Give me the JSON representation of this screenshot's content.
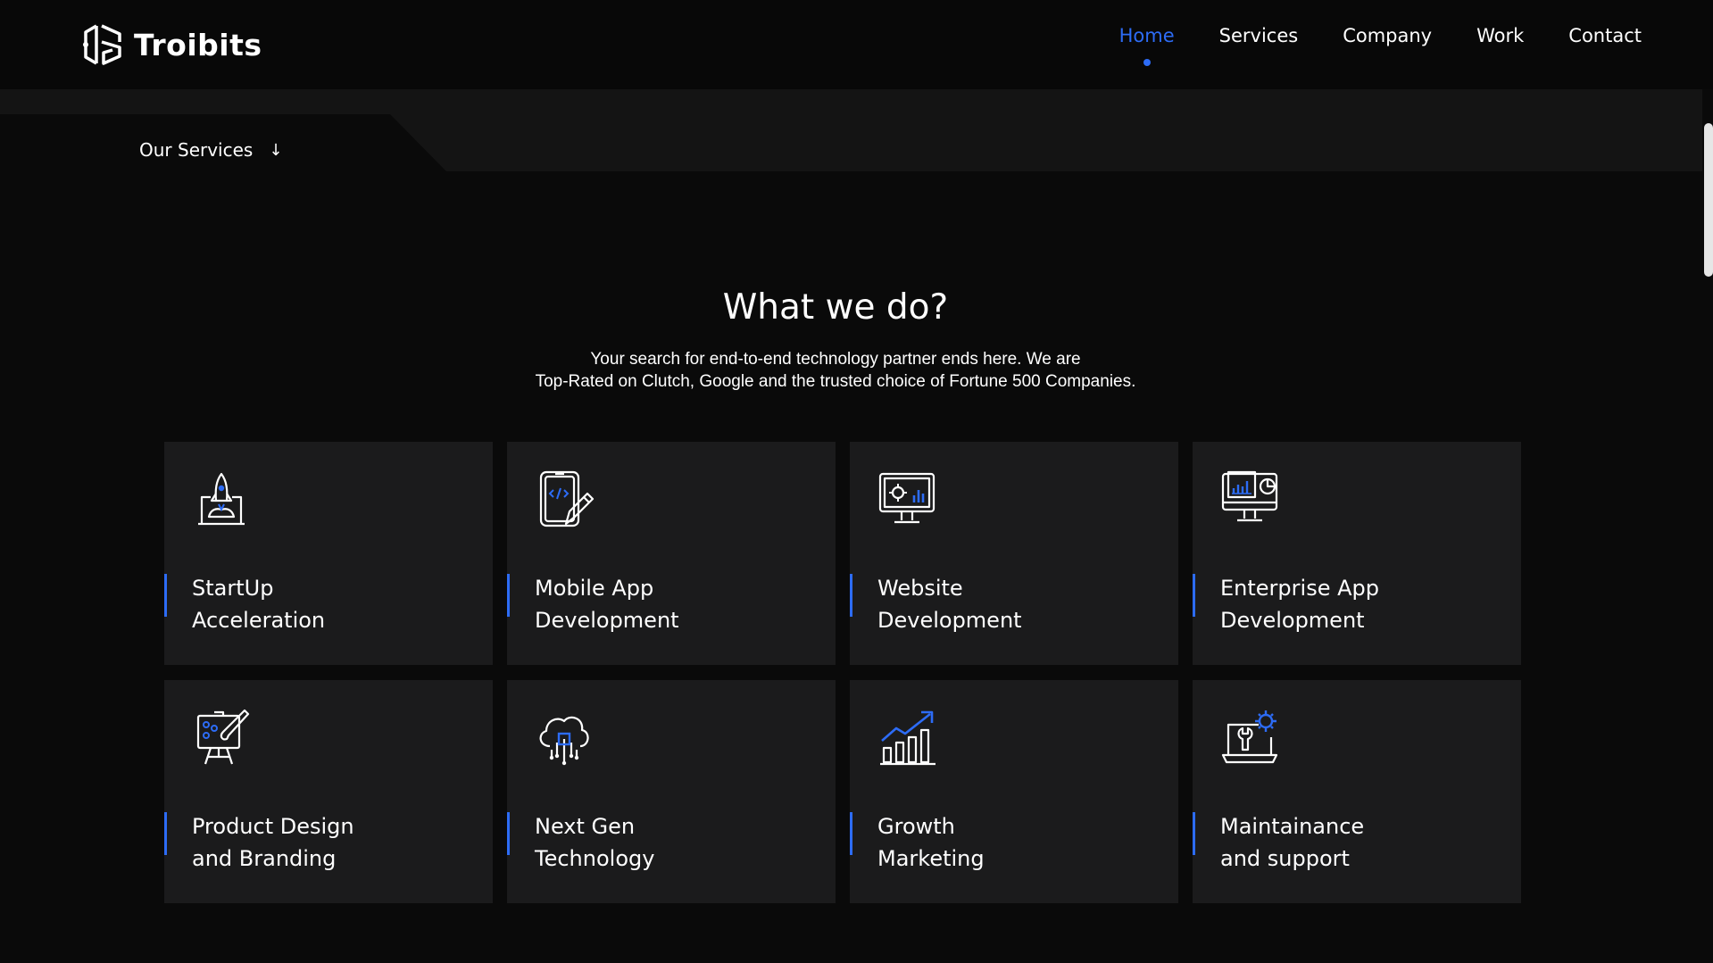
{
  "header": {
    "brand": "Troibits",
    "nav": [
      {
        "label": "Home",
        "active": true
      },
      {
        "label": "Services",
        "active": false
      },
      {
        "label": "Company",
        "active": false
      },
      {
        "label": "Work",
        "active": false
      },
      {
        "label": "Contact",
        "active": false
      }
    ]
  },
  "breadcrumb": {
    "label": "Our Services",
    "arrow": "↓"
  },
  "section": {
    "title": "What we do?",
    "subtitle_line1": "Your search for end-to-end technology partner ends here. We are",
    "subtitle_line2": "Top-Rated on Clutch, Google and the trusted choice of Fortune 500 Companies."
  },
  "services": [
    {
      "title": "StartUp\nAcceleration",
      "icon": "rocket-launch-icon"
    },
    {
      "title": "Mobile App\nDevelopment",
      "icon": "mobile-code-icon"
    },
    {
      "title": "Website\nDevelopment",
      "icon": "monitor-gear-icon"
    },
    {
      "title": "Enterprise App\nDevelopment",
      "icon": "monitor-analytics-icon"
    },
    {
      "title": "Product Design\nand Branding",
      "icon": "design-easel-icon"
    },
    {
      "title": "Next Gen\nTechnology",
      "icon": "cloud-chip-icon"
    },
    {
      "title": "Growth\nMarketing",
      "icon": "growth-chart-icon"
    },
    {
      "title": "Maintainance\nand support",
      "icon": "laptop-wrench-icon"
    }
  ],
  "colors": {
    "accent": "#2d6cf6",
    "background": "#0a0a0a",
    "card": "#1b1b1c",
    "band": "#141414"
  }
}
